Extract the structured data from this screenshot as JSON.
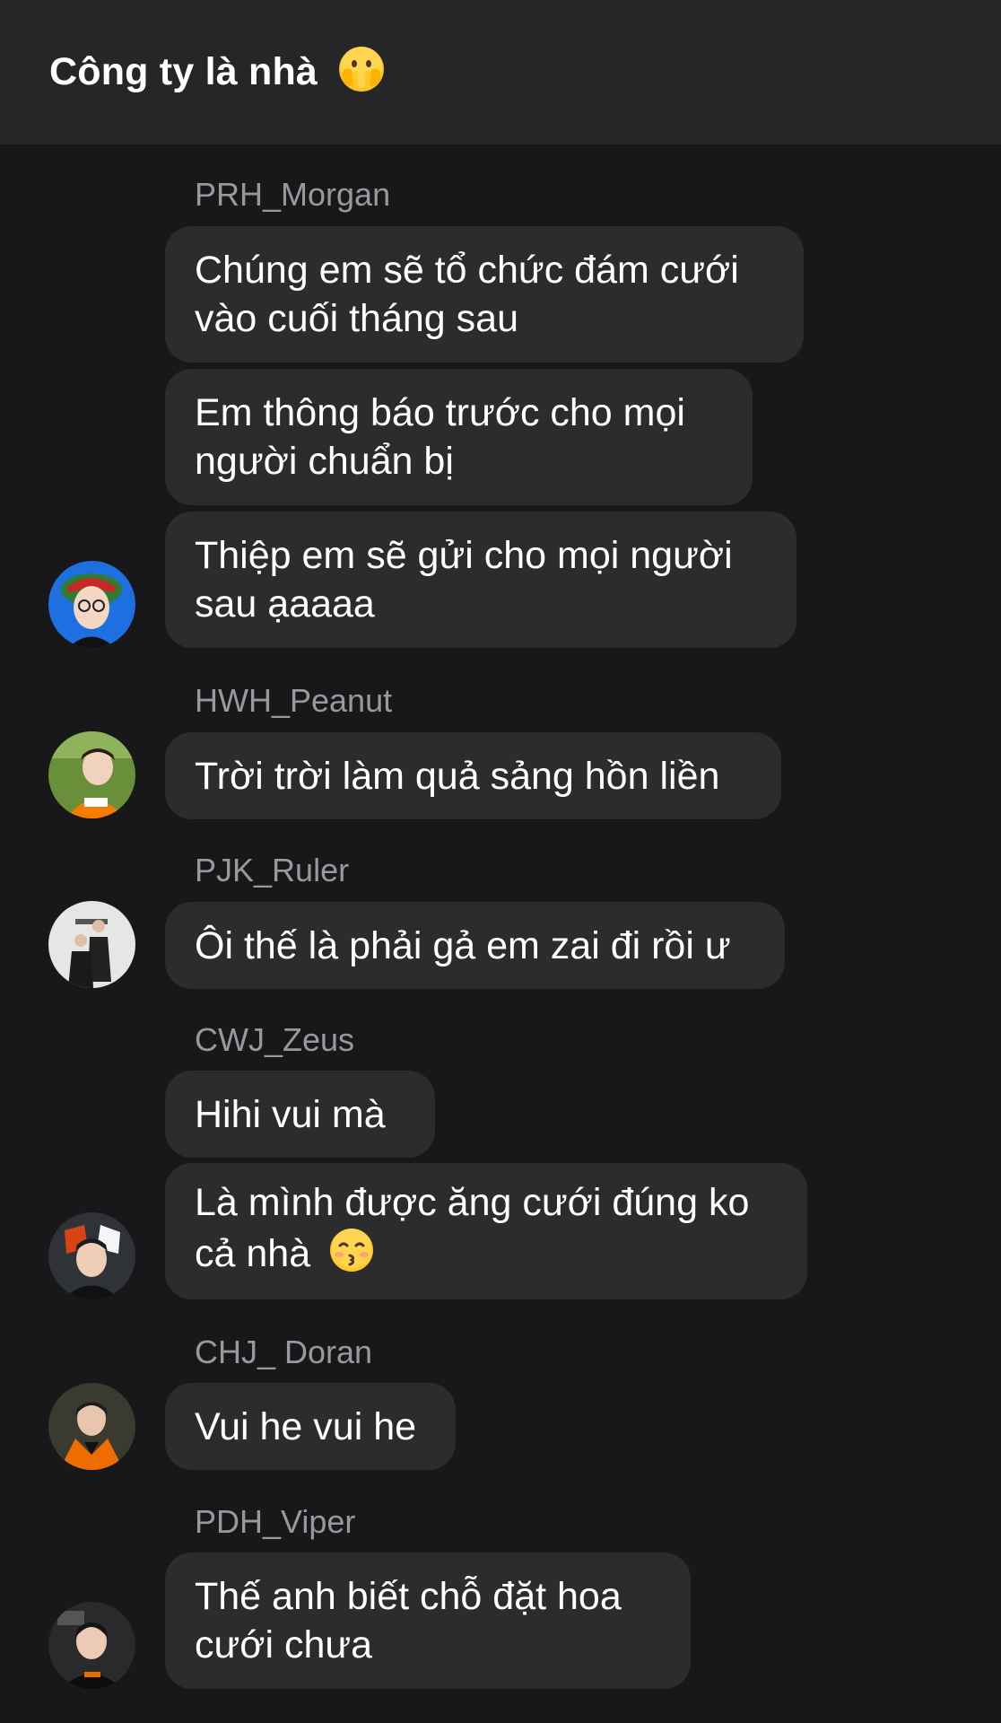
{
  "header": {
    "title": "Công ty là nhà",
    "title_emoji": "face-with-hands-over-mouth"
  },
  "messages": [
    {
      "sender": "PRH_Morgan",
      "avatar": "avatar-morgan",
      "bubbles": [
        [
          "Chúng em sẽ tổ chức đám cưới",
          "vào cuối tháng sau"
        ],
        [
          "Em thông báo trước cho mọi",
          "người chuẩn bị"
        ],
        [
          "Thiệp em sẽ gửi cho mọi người",
          "sau ạaaaa"
        ]
      ]
    },
    {
      "sender": "HWH_Peanut",
      "avatar": "avatar-peanut",
      "bubbles": [
        [
          "Trời trời làm quả sảng hồn liền"
        ]
      ]
    },
    {
      "sender": "PJK_Ruler",
      "avatar": "avatar-ruler",
      "bubbles": [
        [
          "Ôi thế là phải gả em zai đi rồi ư"
        ]
      ]
    },
    {
      "sender": "CWJ_Zeus",
      "avatar": "avatar-zeus",
      "bubbles": [
        [
          "Hihi vui mà"
        ],
        [
          "Là mình được ăng cưới đúng ko",
          "cả nhà"
        ]
      ],
      "last_bubble_emoji": "kissing-face"
    },
    {
      "sender": "CHJ_ Doran",
      "avatar": "avatar-doran",
      "bubbles": [
        [
          "Vui he vui he"
        ]
      ]
    },
    {
      "sender": "PDH_Viper",
      "avatar": "avatar-viper",
      "bubbles": [
        [
          "Thế anh biết chỗ đặt hoa",
          "cưới chưa"
        ]
      ]
    }
  ],
  "colors": {
    "background": "#18181a",
    "header": "#262628",
    "bubble": "#2c2c2e",
    "sender_text": "#98989d",
    "message_text": "#ffffff"
  }
}
